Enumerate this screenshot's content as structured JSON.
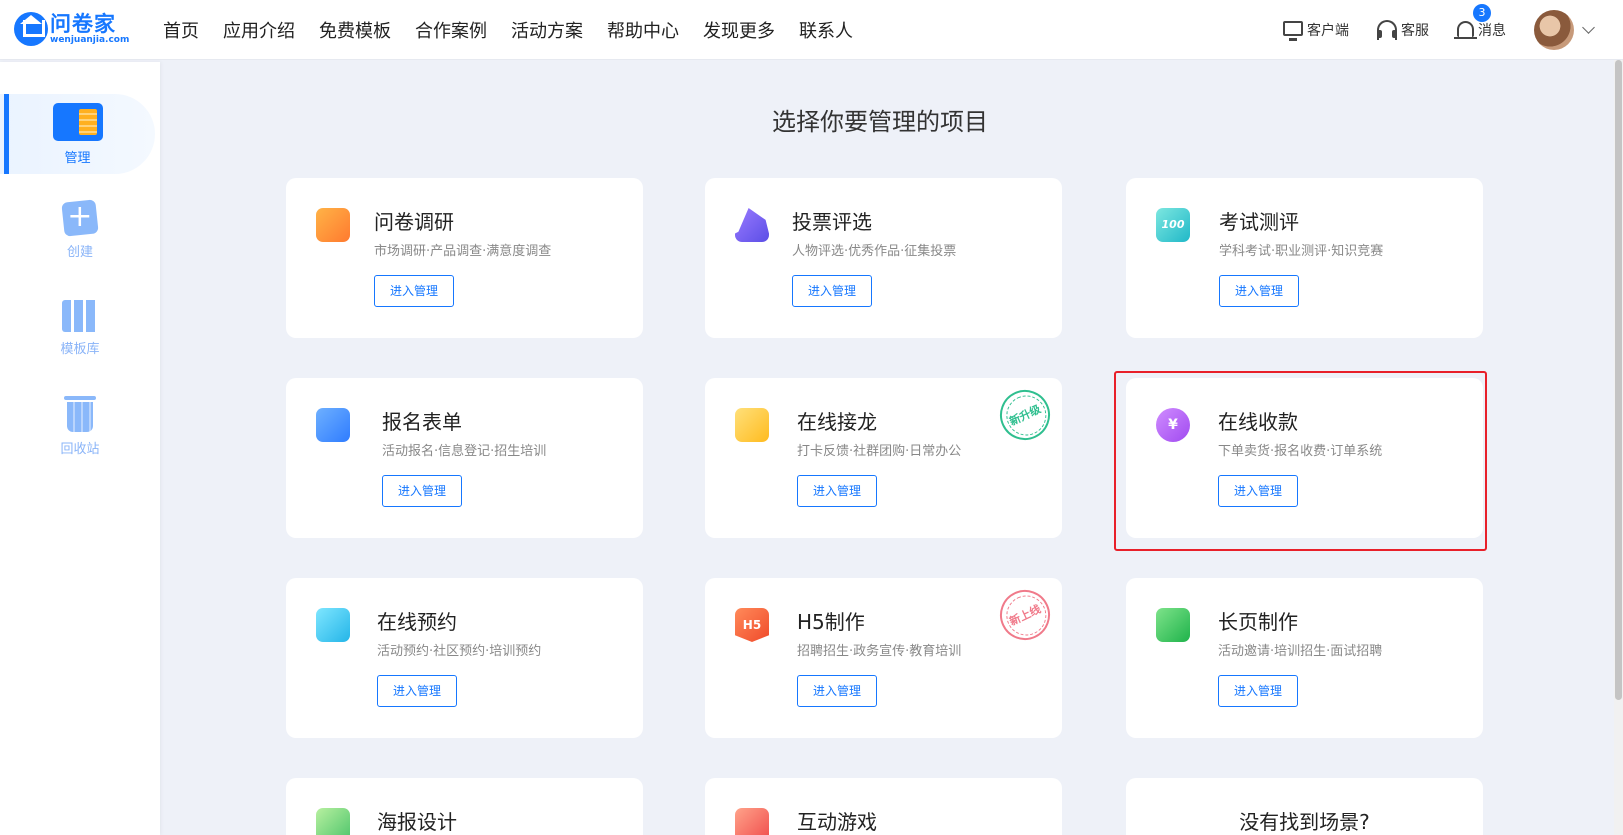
{
  "header": {
    "logo_name": "问卷家",
    "logo_url": "wenjuanjia.com",
    "nav": [
      "首页",
      "应用介绍",
      "免费模板",
      "合作案例",
      "活动方案",
      "帮助中心",
      "发现更多",
      "联系人"
    ],
    "client_label": "客户端",
    "service_label": "客服",
    "message_label": "消息",
    "message_count": "3"
  },
  "sidebar": {
    "items": [
      {
        "label": "管理",
        "icon": "manage-icon",
        "active": true
      },
      {
        "label": "创建",
        "icon": "create-icon"
      },
      {
        "label": "模板库",
        "icon": "template-icon"
      },
      {
        "label": "回收站",
        "icon": "trash-icon"
      }
    ]
  },
  "main": {
    "title": "选择你要管理的项目",
    "button_label": "进入管理",
    "cards": [
      {
        "title": "问卷调研",
        "subtitle": "市场调研·产品调查·满意度调查",
        "icon": "survey-icon"
      },
      {
        "title": "投票评选",
        "subtitle": "人物评选·优秀作品·征集投票",
        "icon": "vote-icon"
      },
      {
        "title": "考试测评",
        "subtitle": "学科考试·职业测评·知识竞赛",
        "icon": "exam-icon",
        "icon_text": "100"
      },
      {
        "title": "报名表单",
        "subtitle": "活动报名·信息登记·招生培训",
        "icon": "form-icon"
      },
      {
        "title": "在线接龙",
        "subtitle": "打卡反馈·社群团购·日常办公",
        "icon": "chain-icon",
        "stamp": "新升级"
      },
      {
        "title": "在线收款",
        "subtitle": "下单卖货·报名收费·订单系统",
        "icon": "payment-icon",
        "icon_text": "¥"
      },
      {
        "title": "在线预约",
        "subtitle": "活动预约·社区预约·培训预约",
        "icon": "calendar-icon"
      },
      {
        "title": "H5制作",
        "subtitle": "招聘招生·政务宣传·教育培训",
        "icon": "h5-icon",
        "icon_text": "H5",
        "stamp": "新上线"
      },
      {
        "title": "长页制作",
        "subtitle": "活动邀请·培训招生·面试招聘",
        "icon": "longpage-icon"
      },
      {
        "title": "海报设计",
        "icon": "poster-icon"
      },
      {
        "title": "互动游戏",
        "icon": "gift-icon"
      }
    ],
    "not_found": "没有找到场景?"
  },
  "colors": {
    "accent": "#1677ff",
    "highlight": "#e8202a",
    "background": "#eef1f8"
  }
}
